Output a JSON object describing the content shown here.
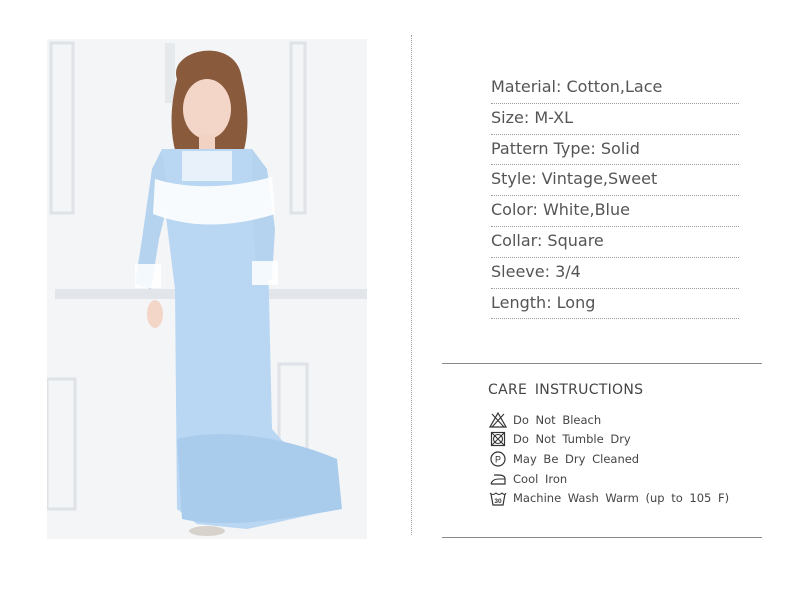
{
  "specs": [
    {
      "label": "Material",
      "value": "Cotton,Lace",
      "text": "Material: Cotton,Lace"
    },
    {
      "label": "Size",
      "value": "M-XL",
      "text": "Size: M-XL"
    },
    {
      "label": "Pattern Type",
      "value": "Solid",
      "text": "Pattern Type: Solid"
    },
    {
      "label": "Style",
      "value": "Vintage,Sweet",
      "text": "Style: Vintage,Sweet"
    },
    {
      "label": "Color",
      "value": "White,Blue",
      "text": "Color: White,Blue"
    },
    {
      "label": "Collar",
      "value": "Square",
      "text": "Collar: Square"
    },
    {
      "label": "Sleeve",
      "value": "3/4",
      "text": "Sleeve: 3/4"
    },
    {
      "label": "Length",
      "value": "Long",
      "text": "Length: Long"
    }
  ],
  "care": {
    "title": "CARE INSTRUCTIONS",
    "items": [
      {
        "icon": "do-not-bleach-icon",
        "text": "Do Not Bleach"
      },
      {
        "icon": "do-not-tumble-dry-icon",
        "text": "Do Not Tumble Dry"
      },
      {
        "icon": "dry-clean-p-icon",
        "text": "May Be Dry Cleaned",
        "glyph": "P"
      },
      {
        "icon": "cool-iron-icon",
        "text": "Cool Iron"
      },
      {
        "icon": "machine-wash-icon",
        "text": "Machine Wash Warm (up to 105 F)",
        "glyph": "30"
      }
    ]
  },
  "colors": {
    "dress": "#b9d7f2",
    "text": "#555555",
    "lace": "#ffffff"
  }
}
